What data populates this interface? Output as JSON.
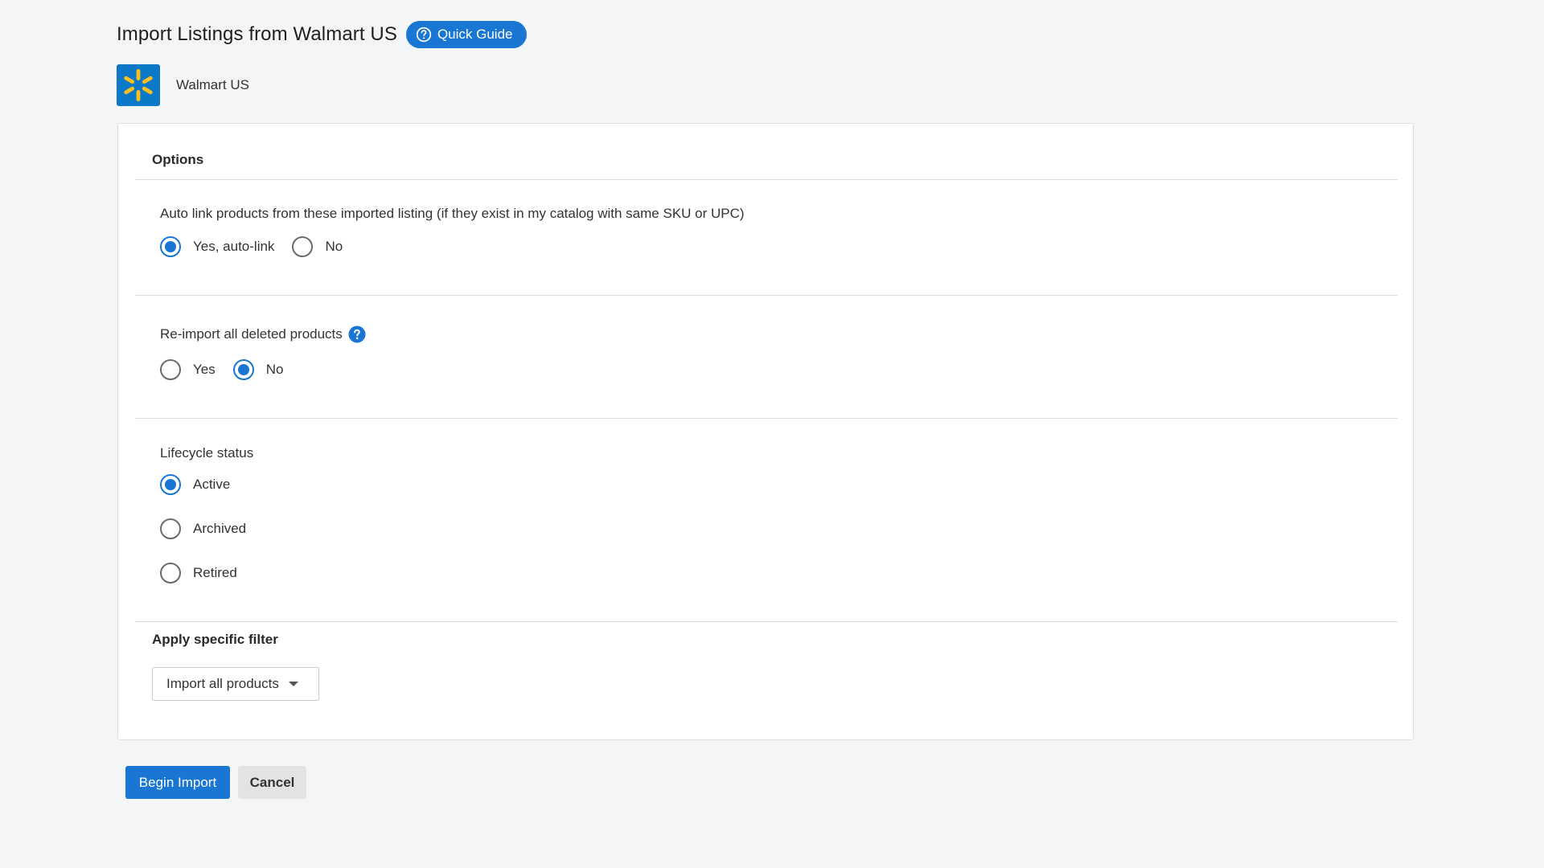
{
  "header": {
    "title": "Import Listings from Walmart US",
    "quick_guide_label": "Quick Guide"
  },
  "channel": {
    "name": "Walmart US",
    "logo_icon": "walmart-spark-icon",
    "logo_bg": "#0c79c8",
    "logo_spark": "#fec020"
  },
  "options": {
    "title": "Options",
    "auto_link": {
      "question": "Auto link products from these imported listing (if they exist in my catalog with same SKU or UPC)",
      "options": [
        {
          "label": "Yes, auto-link",
          "checked": true
        },
        {
          "label": "No",
          "checked": false
        }
      ]
    },
    "reimport": {
      "question": "Re-import all deleted products",
      "help_icon": "question-circle-icon",
      "options": [
        {
          "label": "Yes",
          "checked": false
        },
        {
          "label": "No",
          "checked": true
        }
      ]
    },
    "lifecycle": {
      "question": "Lifecycle status",
      "options": [
        {
          "label": "Active",
          "checked": true
        },
        {
          "label": "Archived",
          "checked": false
        },
        {
          "label": "Retired",
          "checked": false
        }
      ]
    }
  },
  "filter": {
    "title": "Apply specific filter",
    "selected": "Import all products"
  },
  "footer": {
    "begin_label": "Begin Import",
    "cancel_label": "Cancel"
  },
  "colors": {
    "accent": "#1976d2",
    "background": "#f4f5f7"
  }
}
